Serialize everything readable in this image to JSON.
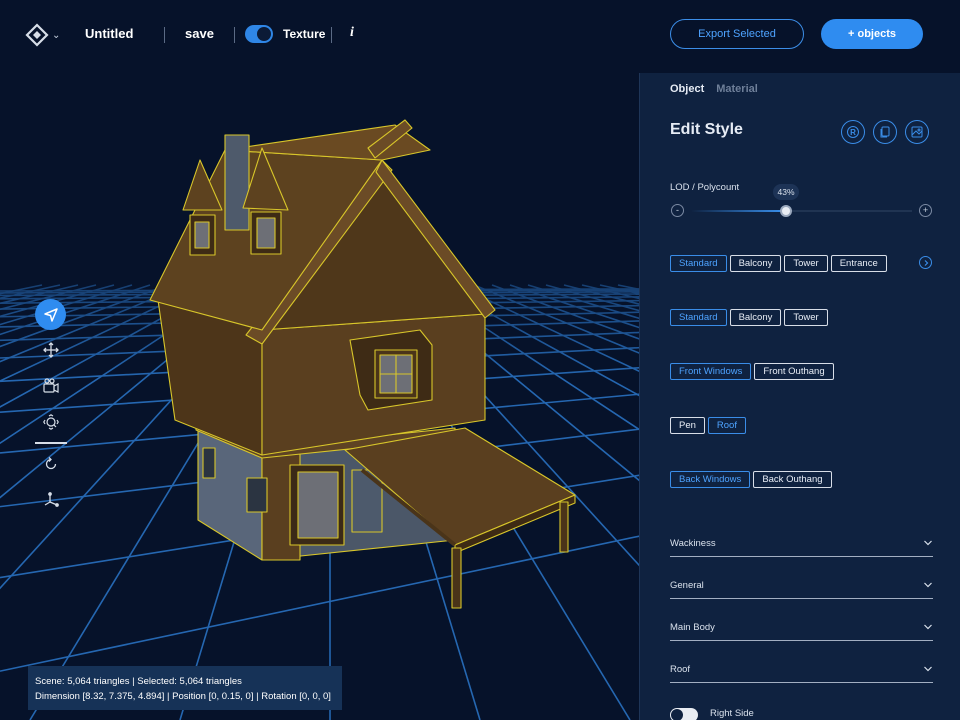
{
  "header": {
    "title": "Untitled",
    "save_label": "save",
    "texture_label": "Texture",
    "texture_on": true,
    "info_label": "i",
    "export_label": "Export Selected",
    "add_label": "+ objects"
  },
  "toolbar": {
    "tools": [
      "select-icon",
      "move-icon",
      "camera-icon",
      "zoom-icon",
      "rotate-icon",
      "axis-icon"
    ],
    "active": "select-icon"
  },
  "status": {
    "line1": "Scene: 5,064 triangles | Selected: 5,064 triangles",
    "line2": "Dimension [8.32, 7.375, 4.894] | Position [0, 0.15, 0] | Rotation [0, 0, 0]"
  },
  "panel": {
    "tabs": [
      "Object",
      "Material"
    ],
    "active_tab": "Object",
    "title": "Edit Style",
    "header_icons": [
      "reset-icon",
      "copy-icon",
      "image-icon"
    ],
    "lod": {
      "label": "LOD / Polycount",
      "value_label": "43%",
      "value": 0.43,
      "minus": "-",
      "plus": "+"
    },
    "chip_rows": [
      {
        "chips": [
          "Standard",
          "Balcony",
          "Tower",
          "Entrance"
        ],
        "selected": [
          0
        ]
      },
      {
        "chips": [
          "Standard",
          "Balcony",
          "Tower"
        ],
        "selected": [
          0
        ]
      },
      {
        "chips": [
          "Front Windows",
          "Front Outhang"
        ],
        "selected": [
          0
        ]
      },
      {
        "chips": [
          "Pen",
          "Roof"
        ],
        "selected": [
          1
        ]
      },
      {
        "chips": [
          "Back Windows",
          "Back Outhang"
        ],
        "selected": [
          0
        ]
      }
    ],
    "sections": [
      "Wackiness",
      "General",
      "Main Body",
      "Roof"
    ],
    "right_side_label": "Right Side"
  },
  "colors": {
    "background": "#06122a",
    "panel": "#0f2240",
    "accent": "#2f8cf0",
    "grid": "#2a78d0",
    "house_wood": "#5a3f1f",
    "house_outline": "#d8c62a",
    "house_stone": "#4f5b6c"
  }
}
